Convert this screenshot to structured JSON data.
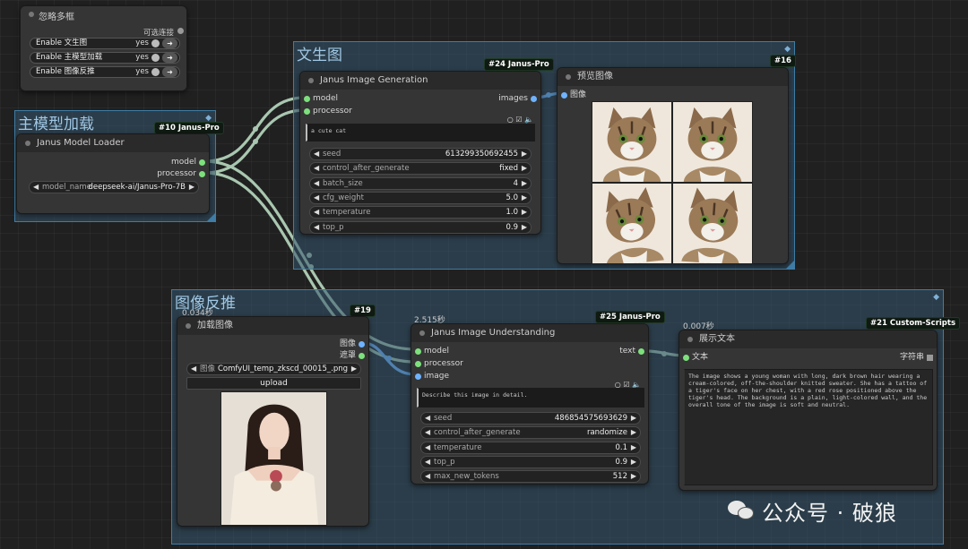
{
  "bypass_panel": {
    "title": "忽略多框",
    "optional_label": "可选连接",
    "rows": [
      {
        "label": "Enable 文生图",
        "value": "yes"
      },
      {
        "label": "Enable 主模型加载",
        "value": "yes"
      },
      {
        "label": "Enable 图像反推",
        "value": "yes"
      }
    ]
  },
  "groups": {
    "text_to_image": "文生图",
    "main_model": "主模型加载",
    "image_reverse": "图像反推"
  },
  "model_loader": {
    "badge": "#10 Janus-Pro",
    "title": "Janus Model Loader",
    "out_model": "model",
    "out_processor": "processor",
    "model_name_label": "model_name",
    "model_name_value": "deepseek-ai/Janus-Pro-7B"
  },
  "image_gen": {
    "badge": "#24 Janus-Pro",
    "title": "Janus Image Generation",
    "in_model": "model",
    "in_processor": "processor",
    "out_images": "images",
    "prompt": "a cute cat",
    "widgets": [
      {
        "label": "seed",
        "value": "613299350692455"
      },
      {
        "label": "control_after_generate",
        "value": "fixed"
      },
      {
        "label": "batch_size",
        "value": "4"
      },
      {
        "label": "cfg_weight",
        "value": "5.0"
      },
      {
        "label": "temperature",
        "value": "1.0"
      },
      {
        "label": "top_p",
        "value": "0.9"
      }
    ]
  },
  "preview": {
    "badge": "#16",
    "title": "预览图像",
    "in_image": "图像"
  },
  "load_image": {
    "badge": "#19",
    "time": "0.034秒",
    "title": "加载图像",
    "out_image": "图像",
    "out_mask": "遮罩",
    "image_label": "图像",
    "image_value": "ComfyUI_temp_zkscd_00015_.png",
    "upload": "upload"
  },
  "understanding": {
    "badge": "#25 Janus-Pro",
    "time": "2.515秒",
    "title": "Janus Image Understanding",
    "in_model": "model",
    "in_processor": "processor",
    "in_image": "image",
    "out_text": "text",
    "prompt": "Describe this image in detail.",
    "widgets": [
      {
        "label": "seed",
        "value": "486854575693629"
      },
      {
        "label": "control_after_generate",
        "value": "randomize"
      },
      {
        "label": "temperature",
        "value": "0.1"
      },
      {
        "label": "top_p",
        "value": "0.9"
      },
      {
        "label": "max_new_tokens",
        "value": "512"
      }
    ]
  },
  "show_text": {
    "badge": "#21 Custom-Scripts",
    "time": "0.007秒",
    "title": "展示文本",
    "in_text": "文本",
    "out_string": "字符串",
    "content": "The image shows a young woman with long, dark brown hair wearing a cream-colored, off-the-shoulder knitted sweater. She has a tattoo of a tiger's face on her chest, with a red rose positioned above the tiger's head. The background is a plain, light-colored wall, and the overall tone of the image is soft and neutral."
  },
  "watermark": "公众号 · 破狼",
  "colors": {
    "group": "#3f7da6",
    "model_socket": "#7de07d",
    "image_socket": "#6fb3ff"
  }
}
